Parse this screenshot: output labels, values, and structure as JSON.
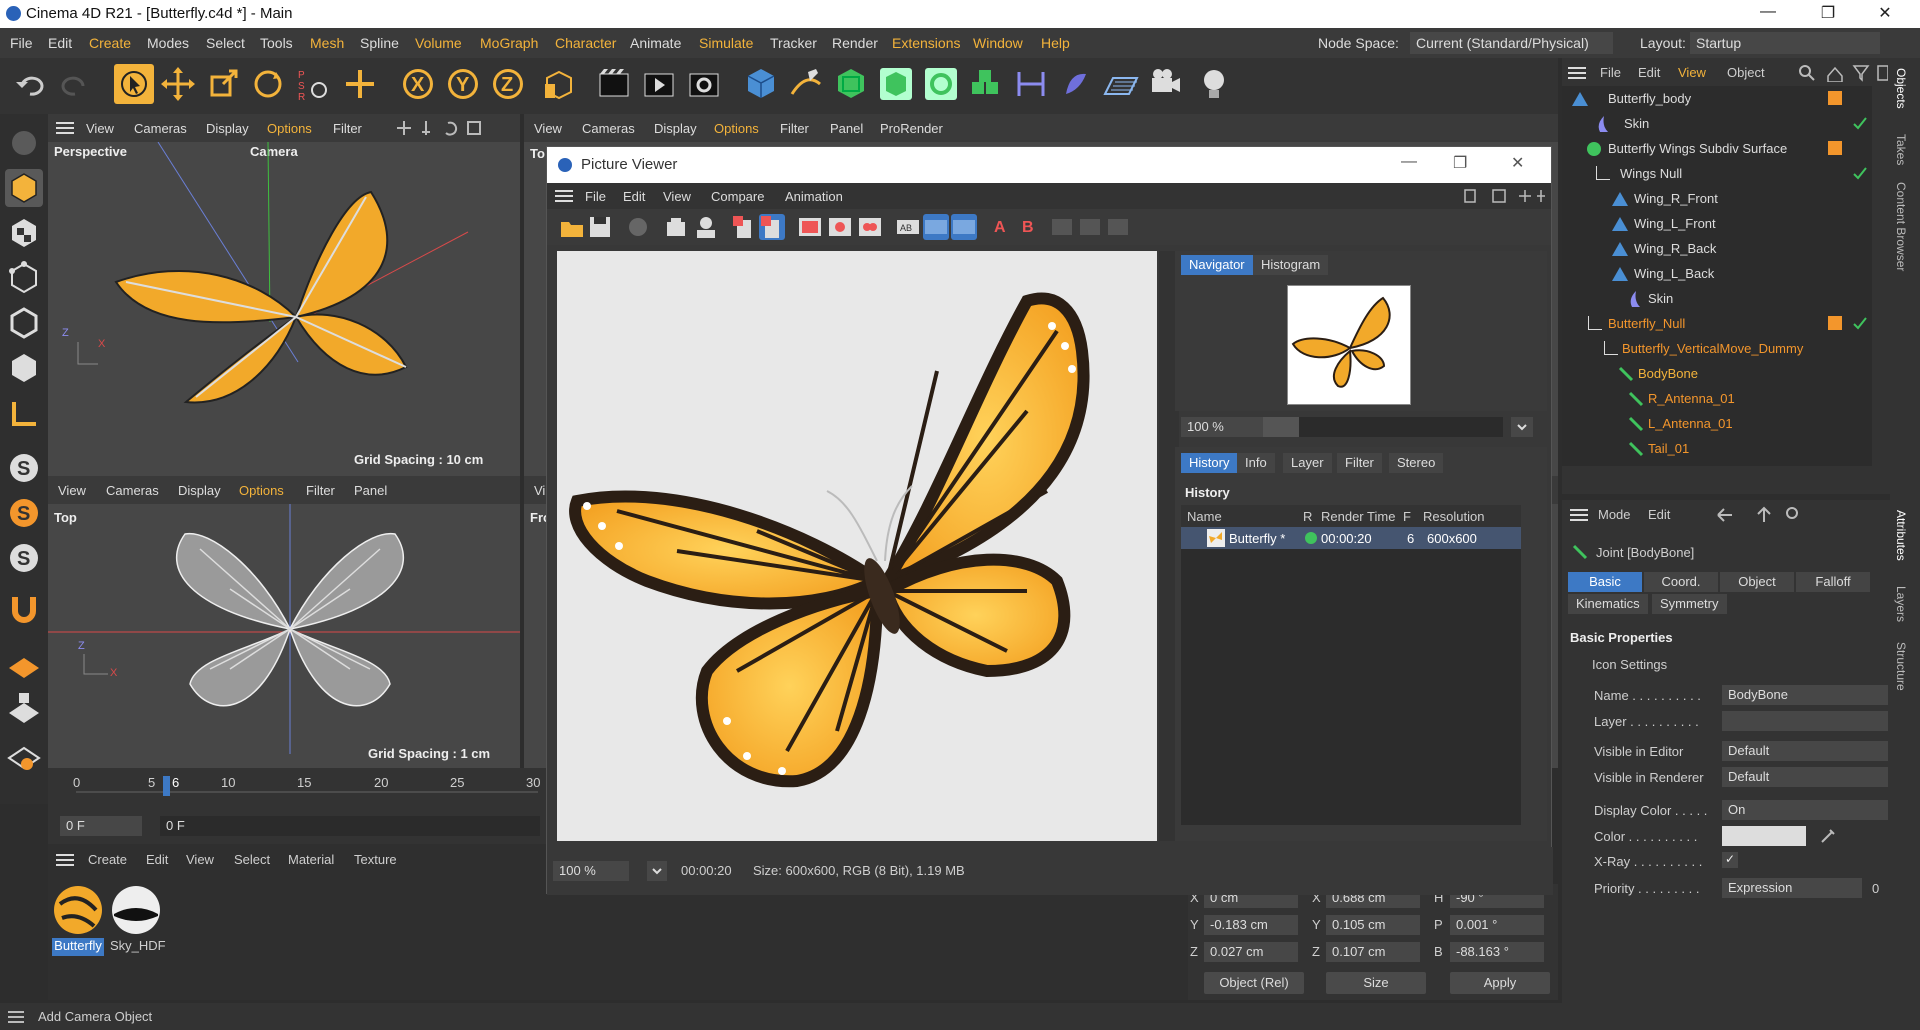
{
  "window": {
    "title": "Cinema 4D R21 - [Butterfly.c4d *] - Main",
    "minimize": "—",
    "maximize": "❐",
    "close": "✕"
  },
  "menubar": {
    "items": [
      "File",
      "Edit",
      "Create",
      "Modes",
      "Select",
      "Tools",
      "Mesh",
      "Spline",
      "Volume",
      "MoGraph",
      "Character",
      "Animate",
      "Simulate",
      "Tracker",
      "Render",
      "Extensions",
      "Window",
      "Help"
    ],
    "node_space_label": "Node Space:",
    "node_space_value": "Current (Standard/Physical)",
    "layout_label": "Layout:",
    "layout_value": "Startup"
  },
  "viewport_persp": {
    "menu": [
      "View",
      "Cameras",
      "Display",
      "Options",
      "Filter"
    ],
    "name": "Perspective",
    "camera": "Camera",
    "grid": "Grid Spacing : 10 cm"
  },
  "viewport_top": {
    "menu": [
      "View",
      "Cameras",
      "Display",
      "Options",
      "Filter",
      "Panel"
    ],
    "name": "Top",
    "grid": "Grid Spacing : 1 cm"
  },
  "viewport_right": {
    "menu": [
      "View",
      "Cameras",
      "Display",
      "Options",
      "Filter",
      "Panel",
      "ProRender"
    ],
    "name_top": "To",
    "name_bottom": "Fro",
    "vi": "Vi"
  },
  "timeline": {
    "ticks": [
      "0",
      "5",
      "10",
      "15",
      "20",
      "25",
      "30"
    ],
    "current": "6",
    "frame_field": "0 F",
    "frame_field2": "0 F"
  },
  "materials": {
    "menu": [
      "Create",
      "Edit",
      "View",
      "Select",
      "Material",
      "Texture"
    ],
    "items": [
      {
        "name": "Butterfly"
      },
      {
        "name": "Sky_HDF"
      }
    ]
  },
  "picture_viewer": {
    "title": "Picture Viewer",
    "menu": [
      "File",
      "Edit",
      "View",
      "Compare",
      "Animation"
    ],
    "nav_tabs": [
      "Navigator",
      "Histogram"
    ],
    "zoom": "100 %",
    "zoom_slider": 0.05,
    "history_tabs": [
      "History",
      "Info",
      "Layer",
      "Filter",
      "Stereo"
    ],
    "history_title": "History",
    "history_columns": [
      "Name",
      "R",
      "Render Time",
      "F",
      "Resolution"
    ],
    "history_rows": [
      {
        "name": "Butterfly *",
        "time": "00:00:20",
        "f": "6",
        "res": "600x600"
      }
    ],
    "bottom_zoom": "100 %",
    "bottom_time": "00:00:20",
    "bottom_size": "Size: 600x600, RGB (8 Bit), 1.19 MB"
  },
  "object_manager": {
    "menu": [
      "File",
      "Edit",
      "View",
      "Object"
    ],
    "rows": [
      {
        "name": "Butterfly_body",
        "orange": false,
        "tag": true,
        "check": false
      },
      {
        "name": "Skin",
        "orange": false,
        "tag": false,
        "check": true
      },
      {
        "name": "Butterfly Wings Subdiv Surface",
        "orange": false,
        "tag": true,
        "check": true
      },
      {
        "name": "Wings Null",
        "orange": false,
        "tag": false,
        "check": false
      },
      {
        "name": "Wing_R_Front",
        "orange": false,
        "tag": false,
        "check": false
      },
      {
        "name": "Wing_L_Front",
        "orange": false,
        "tag": false,
        "check": false
      },
      {
        "name": "Wing_R_Back",
        "orange": false,
        "tag": false,
        "check": false
      },
      {
        "name": "Wing_L_Back",
        "orange": false,
        "tag": false,
        "check": false
      },
      {
        "name": "Skin",
        "orange": false,
        "tag": false,
        "check": true
      },
      {
        "name": "Butterfly_Null",
        "orange": true,
        "tag": true,
        "check": false
      },
      {
        "name": "Butterfly_VerticalMove_Dummy",
        "orange": true,
        "tag": false,
        "check": false
      },
      {
        "name": "BodyBone",
        "orange": true,
        "tag": false,
        "check": false
      },
      {
        "name": "R_Antenna_01",
        "orange": true,
        "tag": false,
        "check": false
      },
      {
        "name": "L_Antenna_01",
        "orange": true,
        "tag": false,
        "check": false
      },
      {
        "name": "Tail_01",
        "orange": true,
        "tag": false,
        "check": false
      }
    ]
  },
  "attributes": {
    "menu": [
      "Mode",
      "Edit"
    ],
    "object": "Joint [BodyBone]",
    "tabs1": [
      "Basic",
      "Coord.",
      "Object",
      "Falloff"
    ],
    "tabs2": [
      "Kinematics",
      "Symmetry"
    ],
    "section": "Basic Properties",
    "icon_settings": "Icon Settings",
    "fields": [
      {
        "label": "Name . . . . . . . . . .",
        "value": "BodyBone"
      },
      {
        "label": "Layer . . . . . . . . . .",
        "value": ""
      },
      {
        "label": "Visible in Editor",
        "value": "Default"
      },
      {
        "label": "Visible in Renderer",
        "value": "Default"
      },
      {
        "label": "Display Color . . . . .",
        "value": "On"
      },
      {
        "label": "Color . . . . . . . . . .",
        "value": ""
      },
      {
        "label": "X-Ray . . . . . . . . . .",
        "value": "✓"
      },
      {
        "label": "Priority . . . . . . . . .",
        "value": "Expression"
      }
    ],
    "priority_num": "0"
  },
  "coords": {
    "rows": [
      {
        "a": "X",
        "v1": "0 cm",
        "b": "X",
        "v2": "0.688 cm",
        "c": "H",
        "v3": "-90 °"
      },
      {
        "a": "Y",
        "v1": "-0.183 cm",
        "b": "Y",
        "v2": "0.105 cm",
        "c": "P",
        "v3": "0.001 °"
      },
      {
        "a": "Z",
        "v1": "0.027 cm",
        "b": "Z",
        "v2": "0.107 cm",
        "c": "B",
        "v3": "-88.163 °"
      }
    ],
    "mode": "Object (Rel)",
    "size": "Size",
    "apply": "Apply"
  },
  "status": {
    "text": "Add Camera Object"
  },
  "side_tabs": [
    "Objects",
    "Takes",
    "Content Browser",
    "Attributes",
    "Layers",
    "Structure"
  ],
  "colors": {
    "accent": "#3d79c5",
    "highlight": "#f3b33b",
    "orange": "#f3962c"
  }
}
